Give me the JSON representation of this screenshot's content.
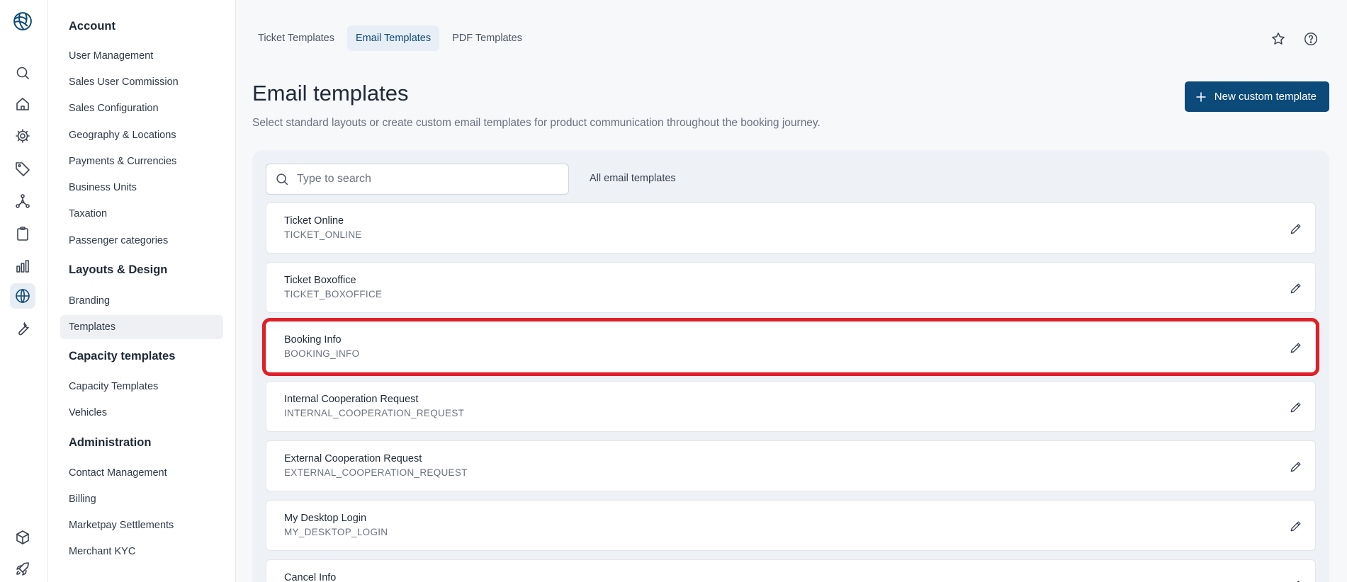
{
  "rail": {
    "icons": [
      "logo-icon",
      "search-icon",
      "home-icon",
      "gear-icon",
      "tag-icon",
      "network-icon",
      "clipboard-icon",
      "bar-chart-icon",
      "globe-icon",
      "wrench-icon",
      "package-icon",
      "rocket-icon"
    ],
    "active": "globe-icon",
    "accent": "#0c4a7a"
  },
  "nav": {
    "sections": [
      {
        "title": "Account",
        "items": [
          "User Management",
          "Sales User Commission",
          "Sales Configuration",
          "Geography & Locations",
          "Payments & Currencies",
          "Business Units",
          "Taxation",
          "Passenger categories"
        ]
      },
      {
        "title": "Layouts & Design",
        "items": [
          "Branding",
          "Templates"
        ]
      },
      {
        "title": "Capacity templates",
        "items": [
          "Capacity Templates",
          "Vehicles"
        ]
      },
      {
        "title": "Administration",
        "items": [
          "Contact Management",
          "Billing",
          "Marketpay Settlements",
          "Merchant KYC"
        ]
      }
    ],
    "active_item": "Templates"
  },
  "tabs": [
    {
      "label": "Ticket Templates",
      "active": false
    },
    {
      "label": "Email Templates",
      "active": true
    },
    {
      "label": "PDF Templates",
      "active": false
    }
  ],
  "header": {
    "title": "Email templates",
    "subtitle": "Select standard layouts or create custom email templates for product communication throughout the booking journey.",
    "new_button_label": "New custom template"
  },
  "search": {
    "placeholder": "Type to search",
    "value": ""
  },
  "filter_label": "All email templates",
  "templates": [
    {
      "name": "Ticket Online",
      "code": "TICKET_ONLINE"
    },
    {
      "name": "Ticket Boxoffice",
      "code": "TICKET_BOXOFFICE"
    },
    {
      "name": "Booking Info",
      "code": "BOOKING_INFO",
      "highlighted": true
    },
    {
      "name": "Internal Cooperation Request",
      "code": "INTERNAL_COOPERATION_REQUEST"
    },
    {
      "name": "External Cooperation Request",
      "code": "EXTERNAL_COOPERATION_REQUEST"
    },
    {
      "name": "My Desktop Login",
      "code": "MY_DESKTOP_LOGIN"
    },
    {
      "name": "Cancel Info",
      "code": ""
    }
  ],
  "colors": {
    "primary": "#0c4a7a",
    "highlight": "#e01f26"
  }
}
